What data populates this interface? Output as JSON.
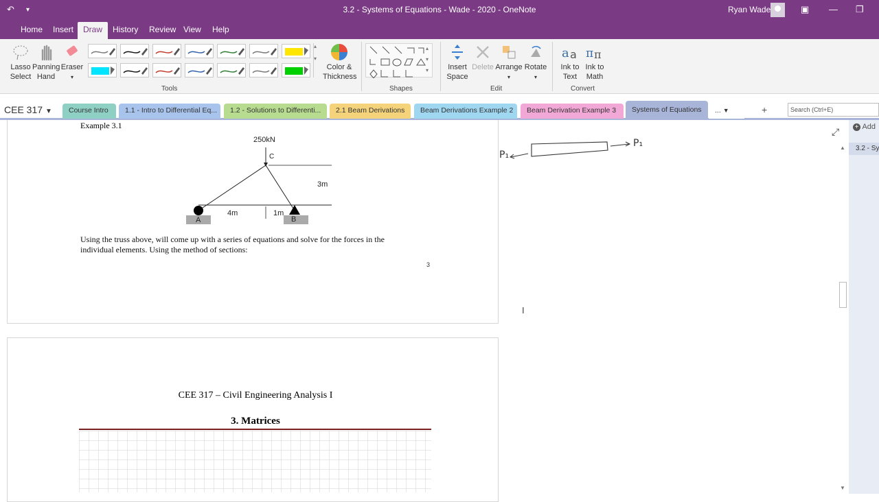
{
  "window": {
    "title": "3.2 - Systems of Equations - Wade - 2020  -  OneNote",
    "user": "Ryan Wade"
  },
  "menu": {
    "tabs": [
      "Home",
      "Insert",
      "Draw",
      "History",
      "Review",
      "View",
      "Help"
    ],
    "active": "Draw"
  },
  "ribbon": {
    "lasso": [
      "Lasso",
      "Select"
    ],
    "panning": [
      "Panning",
      "Hand"
    ],
    "eraser": "Eraser",
    "color_thickness": [
      "Color &",
      "Thickness"
    ],
    "insert_space": [
      "Insert",
      "Space"
    ],
    "delete": "Delete",
    "arrange": "Arrange",
    "rotate": "Rotate",
    "ink_to_text": [
      "Ink to",
      "Text"
    ],
    "ink_to_math": [
      "Ink to",
      "Math"
    ],
    "groups": {
      "tools": "Tools",
      "shapes": "Shapes",
      "edit": "Edit",
      "convert": "Convert"
    },
    "pen_colors_row1": [
      "#777777",
      "#111111",
      "#c0392b",
      "#2f5fa8",
      "#2e7d32",
      "#777777",
      "#ffe600"
    ],
    "pen_colors_row2": [
      "#00e5ff",
      "#111111",
      "#c0392b",
      "#2f5fa8",
      "#2e7d32",
      "#777777",
      "#00d000"
    ]
  },
  "notebook": {
    "name": "CEE 317",
    "sections": [
      {
        "label": "Course Intro",
        "color": "#8fd0c4"
      },
      {
        "label": "1.1 - Intro to Differential Eq...",
        "color": "#a9c4ec"
      },
      {
        "label": "1.2 - Solutions to Differenti...",
        "color": "#b7dc8f"
      },
      {
        "label": "2.1 Beam Derivations",
        "color": "#f4d37a"
      },
      {
        "label": "Beam Derivations Example 2",
        "color": "#9fd6f0"
      },
      {
        "label": "Beam Derivation Example 3",
        "color": "#f2a8d6"
      },
      {
        "label": "Systems of Equations",
        "color": "#a8b4d8"
      }
    ],
    "more": "...",
    "add": "+",
    "search_placeholder": "Search (Ctrl+E)"
  },
  "page1": {
    "heading": "Example 3.1",
    "load": "250kN",
    "node_c": "C",
    "height": "3m",
    "span_a": "4m",
    "span_b": "1m",
    "node_a": "A",
    "node_b": "B",
    "paragraph_line1": "Using the truss above, will come up with a series of equations and solve for the forces in the",
    "paragraph_line2": "individual elements.  Using the method of sections:",
    "page_number": "3"
  },
  "page2": {
    "course_title": "CEE 317 – Civil Engineering Analysis I",
    "chapter": "3.  Matrices"
  },
  "sketch": {
    "left_label": "P₁",
    "right_label": "P₁"
  },
  "right_pane": {
    "add_label": "Add",
    "page_item": "3.2 - Sy"
  }
}
